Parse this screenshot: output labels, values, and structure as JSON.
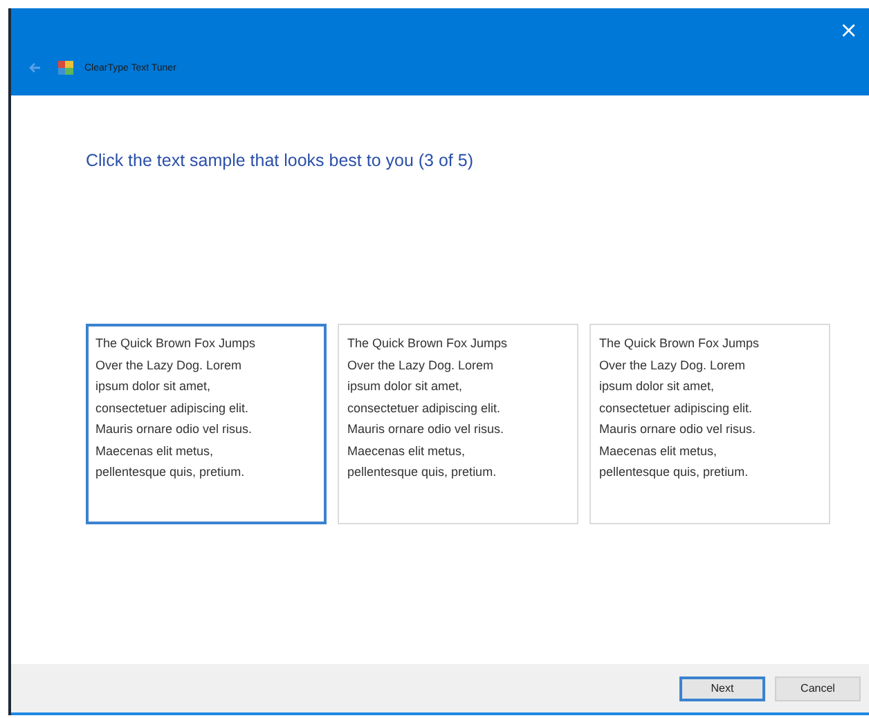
{
  "window": {
    "title": "ClearType Text Tuner",
    "close": "×"
  },
  "heading": "Click the text sample that looks best to you (3 of 5)",
  "samples": [
    {
      "text": "The Quick Brown Fox Jumps\nOver the Lazy Dog. Lorem\nipsum dolor sit amet,\nconsectetuer adipiscing elit.\nMauris ornare odio vel risus.\nMaecenas elit metus,\npellentesque quis, pretium.",
      "selected": true
    },
    {
      "text": "The Quick Brown Fox Jumps\nOver the Lazy Dog. Lorem\nipsum dolor sit amet,\nconsectetuer adipiscing elit.\nMauris ornare odio vel risus.\nMaecenas elit metus,\npellentesque quis, pretium.",
      "selected": false
    },
    {
      "text": "The Quick Brown Fox Jumps\nOver the Lazy Dog. Lorem\nipsum dolor sit amet,\nconsectetuer adipiscing elit.\nMauris ornare odio vel risus.\nMaecenas elit metus,\npellentesque quis, pretium.",
      "selected": false
    }
  ],
  "buttons": [
    {
      "label": "Next",
      "default": true
    },
    {
      "label": "Cancel",
      "default": false
    }
  ]
}
